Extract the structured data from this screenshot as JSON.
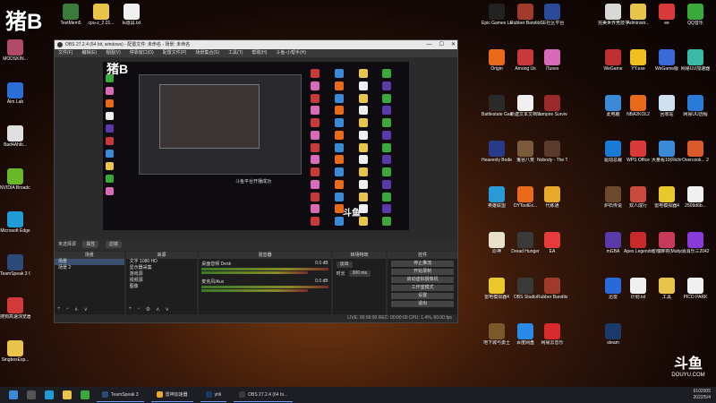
{
  "watermark": "猪B",
  "desktop_left": [
    {
      "label": "MODSKIN...",
      "color": "#b04a6a",
      "icon": "modskin-icon"
    },
    {
      "label": "Aim Lab",
      "color": "#2a6ed6",
      "icon": "aimlab-icon"
    },
    {
      "label": "Bad4Ahib...",
      "color": "#e0e0e0",
      "icon": "file-icon"
    },
    {
      "label": "NVIDIA Broadcast",
      "color": "#6ab82a",
      "icon": "nvidia-icon"
    },
    {
      "label": "Microsoft Edge",
      "color": "#1f9bd8",
      "icon": "edge-icon"
    },
    {
      "label": "TeamSpeak 3 Client",
      "color": "#2c4a7a",
      "icon": "teamspeak-icon"
    },
    {
      "label": "搜狗高速浏览器",
      "color": "#d23a3a",
      "icon": "browser-icon"
    },
    {
      "label": "SingboxExp...",
      "color": "#e8c44a",
      "icon": "folder-icon"
    }
  ],
  "desktop_top": [
    {
      "label": "TestMem5",
      "color": "#3a7a3a",
      "icon": "testmem-icon"
    },
    {
      "label": "cpu-z_2.01...",
      "color": "#e8c44a",
      "icon": "folder-icon"
    },
    {
      "label": "ts道具.txt",
      "color": "#f0f0f0",
      "icon": "text-file-icon"
    }
  ],
  "desktop_right": [
    {
      "label": "Epic Games Launcher",
      "color": "#222222",
      "icon": "epic-icon"
    },
    {
      "label": "Rubber Bandits...",
      "color": "#a03a2a",
      "icon": "game-icon"
    },
    {
      "label": "SE社区平台",
      "color": "#2a4a9a",
      "icon": "se-icon"
    },
    {
      "label": "完美世界竞技平台",
      "color": "#d8d8d8",
      "icon": "perfect-icon"
    },
    {
      "label": "Administr...",
      "color": "#e8c44a",
      "icon": "folder-icon"
    },
    {
      "label": "ee",
      "color": "#d83a3a",
      "icon": "app-icon"
    },
    {
      "label": "QQ音乐",
      "color": "#3aa83a",
      "icon": "qqmusic-icon"
    },
    {
      "label": "Origin",
      "color": "#e86a1a",
      "icon": "origin-icon"
    },
    {
      "label": "Among Us",
      "color": "#c83a3a",
      "icon": "amongus-icon"
    },
    {
      "label": "iTunes",
      "color": "#d86ab8",
      "icon": "itunes-icon"
    },
    {
      "label": "WeGame",
      "color": "#c03030",
      "icon": "wegame-icon"
    },
    {
      "label": "YY.exe",
      "color": "#f0c020",
      "icon": "yy-icon"
    },
    {
      "label": "WeGame版",
      "color": "#3a6ad8",
      "icon": "wegame2-icon"
    },
    {
      "label": "网易UU加速器",
      "color": "#3ab8a8",
      "icon": "uu-icon"
    },
    {
      "label": "Battlestate Games L...",
      "color": "#2a2a2a",
      "icon": "bsg-icon"
    },
    {
      "label": "新建文本文档.txt",
      "color": "#f0f0f0",
      "icon": "text-file-icon"
    },
    {
      "label": "Vampire Survivors",
      "color": "#9a2a2a",
      "icon": "vampire-icon"
    },
    {
      "label": "此电脑",
      "color": "#3a8ad8",
      "icon": "computer-icon"
    },
    {
      "label": "NBA2KOL2",
      "color": "#e86a1a",
      "icon": "nba-icon"
    },
    {
      "label": "回收站",
      "color": "#cfe0f0",
      "icon": "recycle-bin-icon"
    },
    {
      "label": "网易UU远程",
      "color": "#2a7ad8",
      "icon": "remote-icon"
    },
    {
      "label": "Heavenly Bodies",
      "color": "#2a3a8a",
      "icon": "game-icon"
    },
    {
      "label": "鬼谷八荒",
      "color": "#7a5a3a",
      "icon": "game-icon"
    },
    {
      "label": "Nobody - The Turna...",
      "color": "#5a3a2a",
      "icon": "game-icon"
    },
    {
      "label": "驱动总裁",
      "color": "#1a7ad8",
      "icon": "driver-icon"
    },
    {
      "label": "WPS Office",
      "color": "#d83a3a",
      "icon": "wps-icon"
    },
    {
      "label": "大量看10(Richm...",
      "color": "#3a8ad8",
      "icon": "app-icon"
    },
    {
      "label": "Overcook... 2",
      "color": "#d85a2a",
      "icon": "overcooked-icon"
    },
    {
      "label": "英雄联盟",
      "color": "#2a9ad8",
      "icon": "lol-icon"
    },
    {
      "label": "DYToolEx...",
      "color": "#e86a1a",
      "icon": "dytool-icon"
    },
    {
      "label": "代练通",
      "color": "#e8a82a",
      "icon": "app-icon"
    },
    {
      "label": "炉石传说",
      "color": "#6a4a2a",
      "icon": "hearthstone-icon"
    },
    {
      "label": "双人成行",
      "color": "#c84a3a",
      "icon": "game-icon"
    },
    {
      "label": "雷电模拟器4",
      "color": "#e8c82a",
      "icon": "ldplayer-icon"
    },
    {
      "label": "2509d6b...",
      "color": "#f0f0f0",
      "icon": "file-icon"
    },
    {
      "label": "原神",
      "color": "#e8e0c8",
      "icon": "genshin-icon"
    },
    {
      "label": "Dread Hunger",
      "color": "#3a3a3a",
      "icon": "game-icon"
    },
    {
      "label": "EA",
      "color": "#e83a3a",
      "icon": "ea-icon"
    },
    {
      "label": "mGBA",
      "color": "#5a3aa8",
      "icon": "mgba-icon"
    },
    {
      "label": "Apex Legends",
      "color": "#c82a2a",
      "icon": "apex-icon"
    },
    {
      "label": "雀魂麻将(Mahjong...",
      "color": "#c83a5a",
      "icon": "mahjong-icon"
    },
    {
      "label": "消消乐三2042",
      "color": "#8a3ad8",
      "icon": "game-icon"
    },
    {
      "label": "雷电模拟器4",
      "color": "#e8c82a",
      "icon": "ldplayer-icon"
    },
    {
      "label": "OBS Studio",
      "color": "#3a3a3a",
      "icon": "obs-icon"
    },
    {
      "label": "Rubber Bandits...",
      "color": "#a03a2a",
      "icon": "game-icon"
    },
    {
      "label": "迅雷",
      "color": "#2a6ad8",
      "icon": "thunder-icon"
    },
    {
      "label": "计划.txt",
      "color": "#f0f0f0",
      "icon": "text-file-icon"
    },
    {
      "label": "工具",
      "color": "#e8c44a",
      "icon": "folder-icon"
    },
    {
      "label": "PICO PARK",
      "color": "#f0f0f0",
      "icon": "picopark-icon"
    },
    {
      "label": "地下城与勇士",
      "color": "#7a5a2a",
      "icon": "dnf-icon"
    },
    {
      "label": "百度网盘",
      "color": "#2a8ae8",
      "icon": "baidu-icon"
    },
    {
      "label": "网易云音乐",
      "color": "#d82a2a",
      "icon": "netease-icon"
    },
    {
      "label": "steam",
      "color": "#1a3a6a",
      "icon": "steam-icon"
    }
  ],
  "douyu": {
    "mark": "斗鱼",
    "url": "DOUYU.COM"
  },
  "stream_id": "6102005",
  "obs": {
    "title": "OBS 27.2.4 (64 bit, windows) - 配置文件: 未命名 - 场景: 未命名",
    "menu": [
      "文件(F)",
      "编辑(E)",
      "视图(V)",
      "停靠窗口(D)",
      "配置文件(P)",
      "场景集合(S)",
      "工具(T)",
      "帮助(H)",
      "斗鱼-小帮手(H)"
    ],
    "preview_watermark": "猪B",
    "preview_douyu": "斗鱼",
    "preview_caption": "斗鱼平台开播成功",
    "bar_title": "未选择源",
    "bar_props": "属性",
    "bar_filters": "滤镜",
    "docks": {
      "scenes": {
        "title": "场景",
        "items": [
          "场景",
          "场景 2"
        ]
      },
      "sources": {
        "title": "来源",
        "items": [
          "文字  1080 HD",
          "显示器采集",
          "游戏源",
          "视频源",
          "图像"
        ]
      },
      "mixer": {
        "title": "混音器",
        "ch1": "桌面音频 Desk",
        "ch1_db": "0.0 dB",
        "ch2": "麦克风/Aux",
        "ch2_db": "0.0 dB"
      },
      "transitions": {
        "title": "转场特效",
        "type": "淡出",
        "duration_label": "时长",
        "duration": "300 ms"
      },
      "controls": {
        "title": "控件",
        "buttons": [
          "停止推流",
          "开始录制",
          "启动虚拟摄像机",
          "工作室模式",
          "设置",
          "退出"
        ]
      }
    },
    "status": "LIVE: 00:00:00   REC: 00:00:00   CPU: 1.4%, 60.00 fps"
  },
  "taskbar": {
    "apps": [
      {
        "label": "TeamSpeak 3",
        "color": "#2c4a7a"
      },
      {
        "label": "雷神加速器",
        "color": "#e8a82a"
      },
      {
        "label": "yhli",
        "color": "#1a3a6a"
      },
      {
        "label": "OBS 27.2.4 (64 bi...",
        "color": "#3a3a3a"
      }
    ],
    "time": "6102005",
    "date": "2022/5/4"
  }
}
